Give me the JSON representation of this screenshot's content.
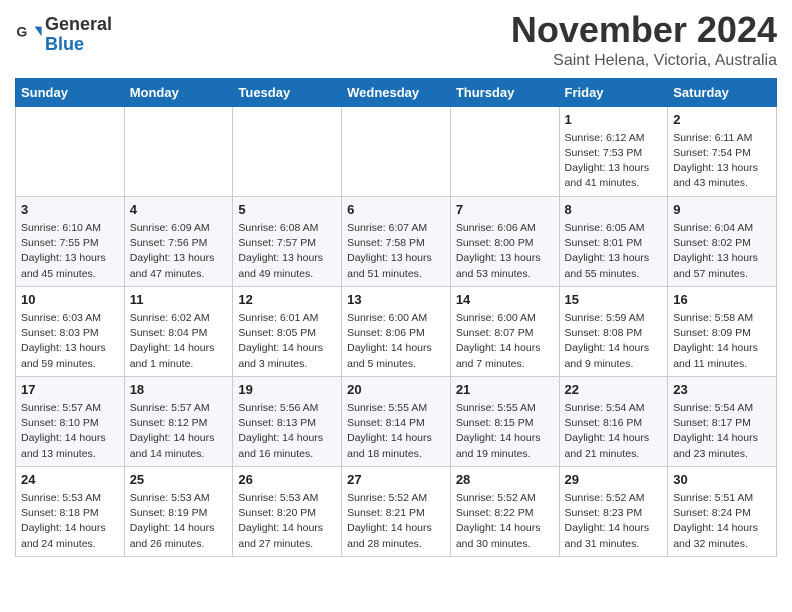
{
  "header": {
    "logo_line1": "General",
    "logo_line2": "Blue",
    "month": "November 2024",
    "location": "Saint Helena, Victoria, Australia"
  },
  "weekdays": [
    "Sunday",
    "Monday",
    "Tuesday",
    "Wednesday",
    "Thursday",
    "Friday",
    "Saturday"
  ],
  "weeks": [
    [
      {
        "day": "",
        "info": ""
      },
      {
        "day": "",
        "info": ""
      },
      {
        "day": "",
        "info": ""
      },
      {
        "day": "",
        "info": ""
      },
      {
        "day": "",
        "info": ""
      },
      {
        "day": "1",
        "info": "Sunrise: 6:12 AM\nSunset: 7:53 PM\nDaylight: 13 hours\nand 41 minutes."
      },
      {
        "day": "2",
        "info": "Sunrise: 6:11 AM\nSunset: 7:54 PM\nDaylight: 13 hours\nand 43 minutes."
      }
    ],
    [
      {
        "day": "3",
        "info": "Sunrise: 6:10 AM\nSunset: 7:55 PM\nDaylight: 13 hours\nand 45 minutes."
      },
      {
        "day": "4",
        "info": "Sunrise: 6:09 AM\nSunset: 7:56 PM\nDaylight: 13 hours\nand 47 minutes."
      },
      {
        "day": "5",
        "info": "Sunrise: 6:08 AM\nSunset: 7:57 PM\nDaylight: 13 hours\nand 49 minutes."
      },
      {
        "day": "6",
        "info": "Sunrise: 6:07 AM\nSunset: 7:58 PM\nDaylight: 13 hours\nand 51 minutes."
      },
      {
        "day": "7",
        "info": "Sunrise: 6:06 AM\nSunset: 8:00 PM\nDaylight: 13 hours\nand 53 minutes."
      },
      {
        "day": "8",
        "info": "Sunrise: 6:05 AM\nSunset: 8:01 PM\nDaylight: 13 hours\nand 55 minutes."
      },
      {
        "day": "9",
        "info": "Sunrise: 6:04 AM\nSunset: 8:02 PM\nDaylight: 13 hours\nand 57 minutes."
      }
    ],
    [
      {
        "day": "10",
        "info": "Sunrise: 6:03 AM\nSunset: 8:03 PM\nDaylight: 13 hours\nand 59 minutes."
      },
      {
        "day": "11",
        "info": "Sunrise: 6:02 AM\nSunset: 8:04 PM\nDaylight: 14 hours\nand 1 minute."
      },
      {
        "day": "12",
        "info": "Sunrise: 6:01 AM\nSunset: 8:05 PM\nDaylight: 14 hours\nand 3 minutes."
      },
      {
        "day": "13",
        "info": "Sunrise: 6:00 AM\nSunset: 8:06 PM\nDaylight: 14 hours\nand 5 minutes."
      },
      {
        "day": "14",
        "info": "Sunrise: 6:00 AM\nSunset: 8:07 PM\nDaylight: 14 hours\nand 7 minutes."
      },
      {
        "day": "15",
        "info": "Sunrise: 5:59 AM\nSunset: 8:08 PM\nDaylight: 14 hours\nand 9 minutes."
      },
      {
        "day": "16",
        "info": "Sunrise: 5:58 AM\nSunset: 8:09 PM\nDaylight: 14 hours\nand 11 minutes."
      }
    ],
    [
      {
        "day": "17",
        "info": "Sunrise: 5:57 AM\nSunset: 8:10 PM\nDaylight: 14 hours\nand 13 minutes."
      },
      {
        "day": "18",
        "info": "Sunrise: 5:57 AM\nSunset: 8:12 PM\nDaylight: 14 hours\nand 14 minutes."
      },
      {
        "day": "19",
        "info": "Sunrise: 5:56 AM\nSunset: 8:13 PM\nDaylight: 14 hours\nand 16 minutes."
      },
      {
        "day": "20",
        "info": "Sunrise: 5:55 AM\nSunset: 8:14 PM\nDaylight: 14 hours\nand 18 minutes."
      },
      {
        "day": "21",
        "info": "Sunrise: 5:55 AM\nSunset: 8:15 PM\nDaylight: 14 hours\nand 19 minutes."
      },
      {
        "day": "22",
        "info": "Sunrise: 5:54 AM\nSunset: 8:16 PM\nDaylight: 14 hours\nand 21 minutes."
      },
      {
        "day": "23",
        "info": "Sunrise: 5:54 AM\nSunset: 8:17 PM\nDaylight: 14 hours\nand 23 minutes."
      }
    ],
    [
      {
        "day": "24",
        "info": "Sunrise: 5:53 AM\nSunset: 8:18 PM\nDaylight: 14 hours\nand 24 minutes."
      },
      {
        "day": "25",
        "info": "Sunrise: 5:53 AM\nSunset: 8:19 PM\nDaylight: 14 hours\nand 26 minutes."
      },
      {
        "day": "26",
        "info": "Sunrise: 5:53 AM\nSunset: 8:20 PM\nDaylight: 14 hours\nand 27 minutes."
      },
      {
        "day": "27",
        "info": "Sunrise: 5:52 AM\nSunset: 8:21 PM\nDaylight: 14 hours\nand 28 minutes."
      },
      {
        "day": "28",
        "info": "Sunrise: 5:52 AM\nSunset: 8:22 PM\nDaylight: 14 hours\nand 30 minutes."
      },
      {
        "day": "29",
        "info": "Sunrise: 5:52 AM\nSunset: 8:23 PM\nDaylight: 14 hours\nand 31 minutes."
      },
      {
        "day": "30",
        "info": "Sunrise: 5:51 AM\nSunset: 8:24 PM\nDaylight: 14 hours\nand 32 minutes."
      }
    ]
  ]
}
